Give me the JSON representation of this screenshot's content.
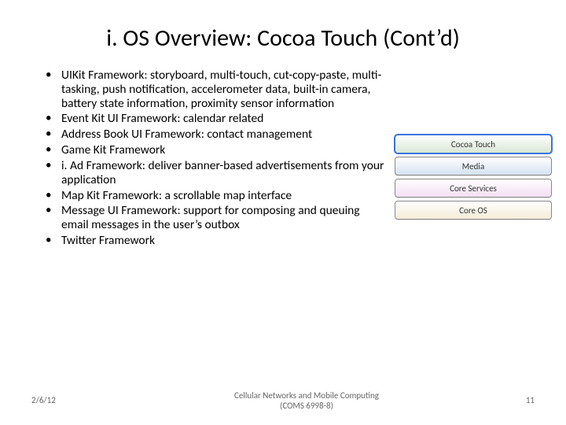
{
  "title": "i. OS Overview: Cocoa Touch (Cont’d)",
  "bullets": [
    "UIKit Framework: storyboard, multi-touch, cut-copy-paste, multi-tasking, push notification, accelerometer data, built-in camera, battery state information, proximity sensor information",
    "Event Kit UI Framework: calendar related",
    "Address Book UI Framework: contact management",
    "Game Kit Framework",
    "i. Ad Framework: deliver banner-based advertisements from your application",
    "Map Kit Framework: a scrollable map interface",
    "Message UI Framework: support for composing and queuing email messages in the user’s outbox",
    "Twitter Framework"
  ],
  "layers": [
    {
      "label": "Cocoa Touch",
      "bg": "#d9e6d4",
      "highlight": true
    },
    {
      "label": "Media",
      "bg": "#d4e2f0",
      "highlight": false
    },
    {
      "label": "Core Services",
      "bg": "#f3def2",
      "highlight": false
    },
    {
      "label": "Core OS",
      "bg": "#f4ecd8",
      "highlight": false
    }
  ],
  "footer": {
    "date": "2/6/12",
    "course_line1": "Cellular Networks and Mobile Computing",
    "course_line2": "(COMS 6998-8)",
    "page": "11"
  }
}
